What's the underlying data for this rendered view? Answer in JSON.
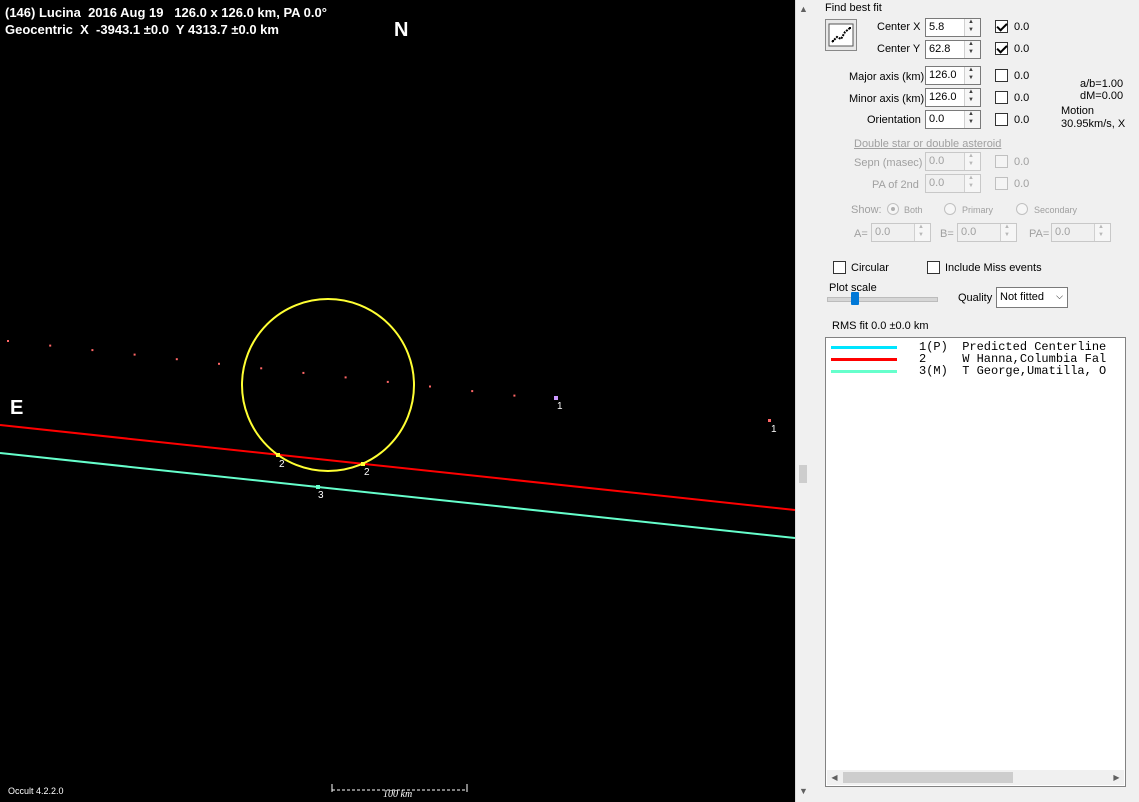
{
  "plot": {
    "header_line1": "(146) Lucina  2016 Aug 19   126.0 x 126.0 km, PA 0.0°",
    "header_line2": "Geocentric  X  -3943.1 ±0.0  Y 4313.7 ±0.0 km",
    "north": "N",
    "east": "E",
    "version": "Occult 4.2.2.0",
    "scale_label": "100 km",
    "chord_labels": {
      "c1_near": "1",
      "c1_far": "1",
      "c2_left": "2",
      "c2_right": "2",
      "c3": "3"
    },
    "colors": {
      "ellipse": "#ffff33",
      "chord2": "#ff0000",
      "chord3": "#66ffcc",
      "centerline_dots": "#ff6666"
    }
  },
  "panel": {
    "find_best_fit": "Find best fit",
    "center_x": {
      "label": "Center X",
      "value": "5.8",
      "checked": true,
      "weight": "0.0"
    },
    "center_y": {
      "label": "Center Y",
      "value": "62.8",
      "checked": true,
      "weight": "0.0"
    },
    "major_axis": {
      "label": "Major axis (km)",
      "value": "126.0",
      "checked": false,
      "weight": "0.0"
    },
    "minor_axis": {
      "label": "Minor axis (km)",
      "value": "126.0",
      "checked": false,
      "weight": "0.0"
    },
    "orientation": {
      "label": "Orientation",
      "value": "0.0",
      "checked": false,
      "weight": "0.0"
    },
    "ab_ratio": "a/b=1.00",
    "dm": "dM=0.00",
    "motion_label": "Motion",
    "motion_value": "30.95km/s, X",
    "double_star_link": "Double star  or  double asteroid",
    "sepn": {
      "label": "Sepn (masec)",
      "value": "0.0",
      "weight": "0.0"
    },
    "pa2nd": {
      "label": "PA of 2nd",
      "value": "0.0",
      "weight": "0.0"
    },
    "show_label": "Show:",
    "show_both": "Both",
    "show_primary": "Primary",
    "show_secondary": "Secondary",
    "a_label": "A=",
    "a_value": "0.0",
    "b_label": "B=",
    "b_value": "0.0",
    "pa_label": "PA=",
    "pa_value": "0.0",
    "circular": "Circular",
    "include_miss": "Include Miss events",
    "plot_scale": "Plot scale",
    "quality_label": "Quality",
    "quality_value": "Not fitted",
    "rms_fit": "RMS fit 0.0 ±0.0 km",
    "legend": [
      {
        "color": "#00e5ff",
        "text": "1(P)  Predicted Centerline"
      },
      {
        "color": "#ff0000",
        "text": "2     W Hanna,Columbia Fal"
      },
      {
        "color": "#66ffcc",
        "text": "3(M)  T George,Umatilla, O"
      }
    ]
  }
}
